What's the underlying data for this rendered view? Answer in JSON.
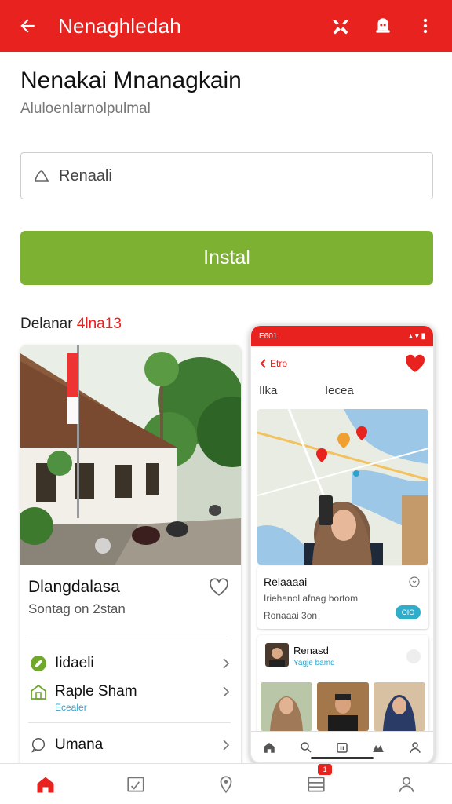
{
  "appbar": {
    "title": "Nenaghledah",
    "icons": [
      "arrow-back-icon",
      "tools-icon",
      "robot-icon",
      "more-vert-icon"
    ],
    "color": "#e8231f"
  },
  "page": {
    "title": "Nenakai Mnanagkain",
    "subtitle": "Aluloenlarnolpulmal"
  },
  "search": {
    "placeholder": "Renaali",
    "icon": "location-icon"
  },
  "install_button": {
    "label": "Instal",
    "color": "#7cb132"
  },
  "section": {
    "label": "Delanar ",
    "label_accent": "4lna13"
  },
  "card": {
    "title": "Dlangdalasa",
    "subtitle": "Sontag on 2stan",
    "rows": [
      {
        "label": "Iidaeli",
        "icon": "leaf-icon"
      },
      {
        "label": "Raple Sham",
        "sub": "Ecealer",
        "icon": "house-icon"
      },
      {
        "label": "Umana",
        "icon": "chat-icon"
      }
    ]
  },
  "phone": {
    "status_left": "E601",
    "back_label": "Etro",
    "tabs": [
      "Ilka",
      "Iecea"
    ],
    "info1": {
      "title": "Relaaaai",
      "desc": "Iriehanol afnag bortom",
      "meta": "Ronaaai 3on",
      "pill": "OIO"
    },
    "info2": {
      "name": "Renasd",
      "sub": "Yagje bamd"
    }
  },
  "bottom_nav": {
    "tabs": [
      "home-icon",
      "chart-icon",
      "location-icon",
      "list-icon",
      "profile-icon"
    ],
    "badge": "1"
  }
}
